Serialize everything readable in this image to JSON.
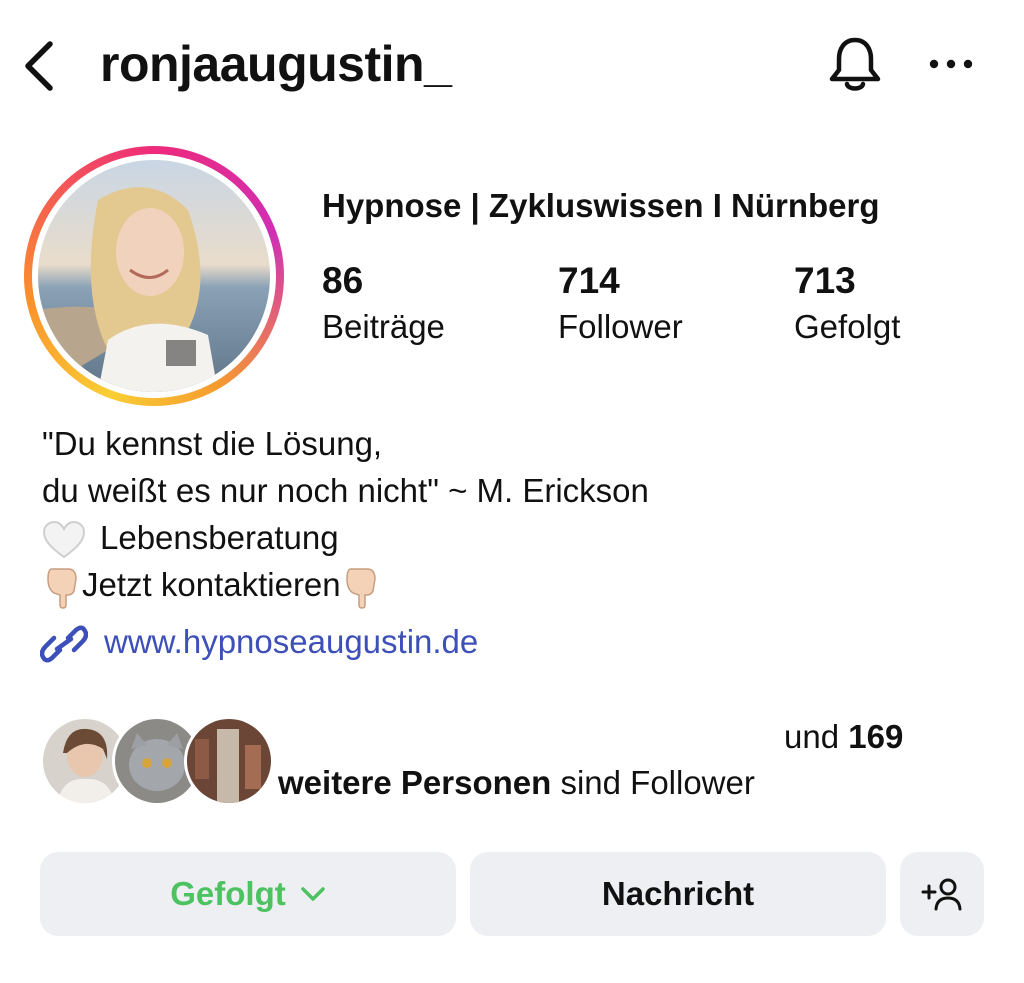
{
  "header": {
    "username": "ronjaaugustin_",
    "icons": [
      "back-icon",
      "bell-icon",
      "more-icon"
    ]
  },
  "profile": {
    "display_name": "Hypnose | Zykluswissen I Nürnberg",
    "stats": [
      {
        "value": "86",
        "label": "Beiträge"
      },
      {
        "value": "714",
        "label": "Follower"
      },
      {
        "value": "713",
        "label": "Gefolgt"
      }
    ]
  },
  "bio": {
    "line1": "\"Du kennst die Lösung,",
    "line2": "du weißt es nur noch nicht\" ~ M. Erickson",
    "line3": "Lebensberatung",
    "line4": "Jetzt kontaktieren",
    "link": "www.hypnoseaugustin.de"
  },
  "followed_by": {
    "und": "und",
    "count": "169",
    "bold_text": "weitere Personen",
    "suffix": "sind Follower"
  },
  "actions": {
    "follow_label": "Gefolgt",
    "message_label": "Nachricht"
  },
  "colors": {
    "accent_green": "#4cc261",
    "link_blue": "#3d4fb8",
    "button_bg": "#eeeff2"
  }
}
